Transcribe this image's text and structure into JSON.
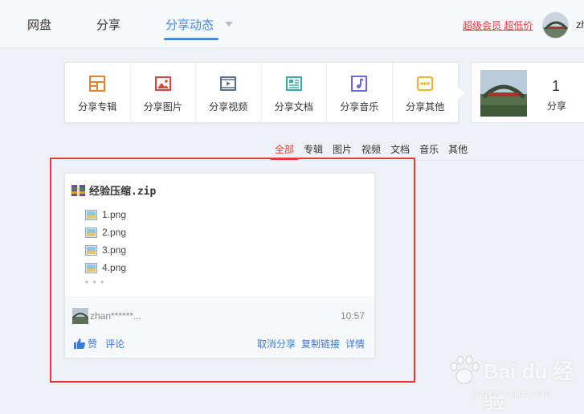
{
  "nav": {
    "items": [
      "网盘",
      "分享",
      "分享动态"
    ],
    "vip_link": "超级会员 超低价",
    "user_short": "zh"
  },
  "share_bar": {
    "buttons": [
      {
        "label": "分享专辑",
        "icon": "album-icon",
        "color": "#e8822a"
      },
      {
        "label": "分享图片",
        "icon": "picture-icon",
        "color": "#d9453b"
      },
      {
        "label": "分享视频",
        "icon": "video-icon",
        "color": "#5a6f8f"
      },
      {
        "label": "分享文档",
        "icon": "document-icon",
        "color": "#32aab0"
      },
      {
        "label": "分享音乐",
        "icon": "music-icon",
        "color": "#6a6ad9"
      },
      {
        "label": "分享其他",
        "icon": "other-icon",
        "color": "#f0b429"
      }
    ]
  },
  "profile": {
    "count": "1",
    "label": "分享"
  },
  "filters": {
    "items": [
      "全部",
      "专辑",
      "图片",
      "视频",
      "文档",
      "音乐",
      "其他"
    ],
    "active": "全部"
  },
  "card": {
    "file_name": "经验压缩.zip",
    "files": [
      "1.png",
      "2.png",
      "3.png",
      "4.png"
    ],
    "more": "• • •",
    "username": "zhan******...",
    "time": "10:57",
    "like": "赞",
    "comment": "评论",
    "actions": [
      "取消分享",
      "复制链接",
      "详情"
    ]
  },
  "watermark": {
    "brand": "Bai du 经验",
    "url": "jingyan.baidu.com"
  },
  "colors": {
    "accent_blue": "#3b8cff",
    "accent_red": "#e4393c",
    "highlight_border": "#e53b3b"
  }
}
